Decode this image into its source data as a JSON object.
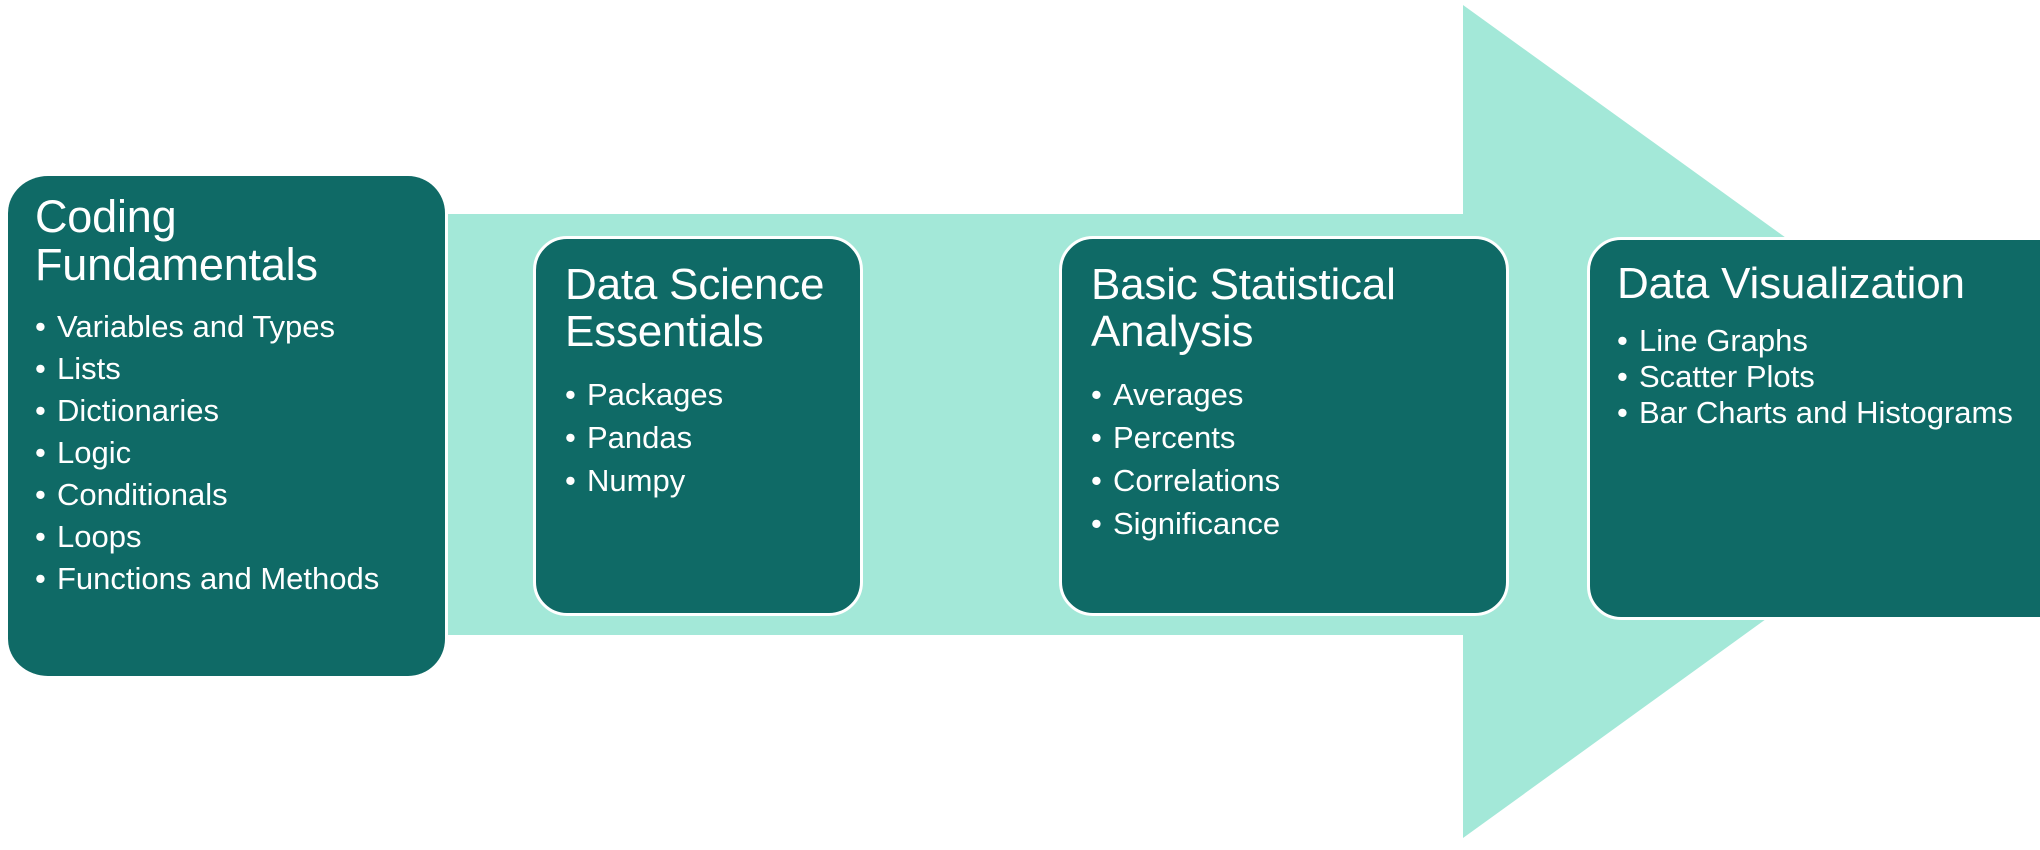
{
  "diagram": {
    "type": "process-arrow",
    "colors": {
      "stage_fill": "#0f6a66",
      "arrow_fill": "#a3e8d8",
      "text": "#ffffff",
      "background": "#ffffff",
      "stage_outline": "#ffffff"
    },
    "arrow": {
      "name": "right-pointing-process-arrow",
      "direction": "right"
    },
    "stages": [
      {
        "title": "Coding\nFundamentals",
        "bullet_marker": "•",
        "bullets": [
          "Variables and Types",
          "Lists",
          "Dictionaries",
          "Logic",
          "Conditionals",
          "Loops",
          "Functions and Methods"
        ]
      },
      {
        "title": "Data Science\nEssentials",
        "bullet_marker": "•",
        "bullets": [
          "Packages",
          "Pandas",
          "Numpy"
        ]
      },
      {
        "title": "Basic Statistical\nAnalysis",
        "bullet_marker": "•",
        "bullets": [
          "Averages",
          "Percents",
          "Correlations",
          "Significance"
        ]
      },
      {
        "title": "Data Visualization",
        "bullet_marker": "•",
        "bullets": [
          "Line Graphs",
          "Scatter Plots",
          "Bar Charts and Histograms"
        ]
      }
    ]
  }
}
